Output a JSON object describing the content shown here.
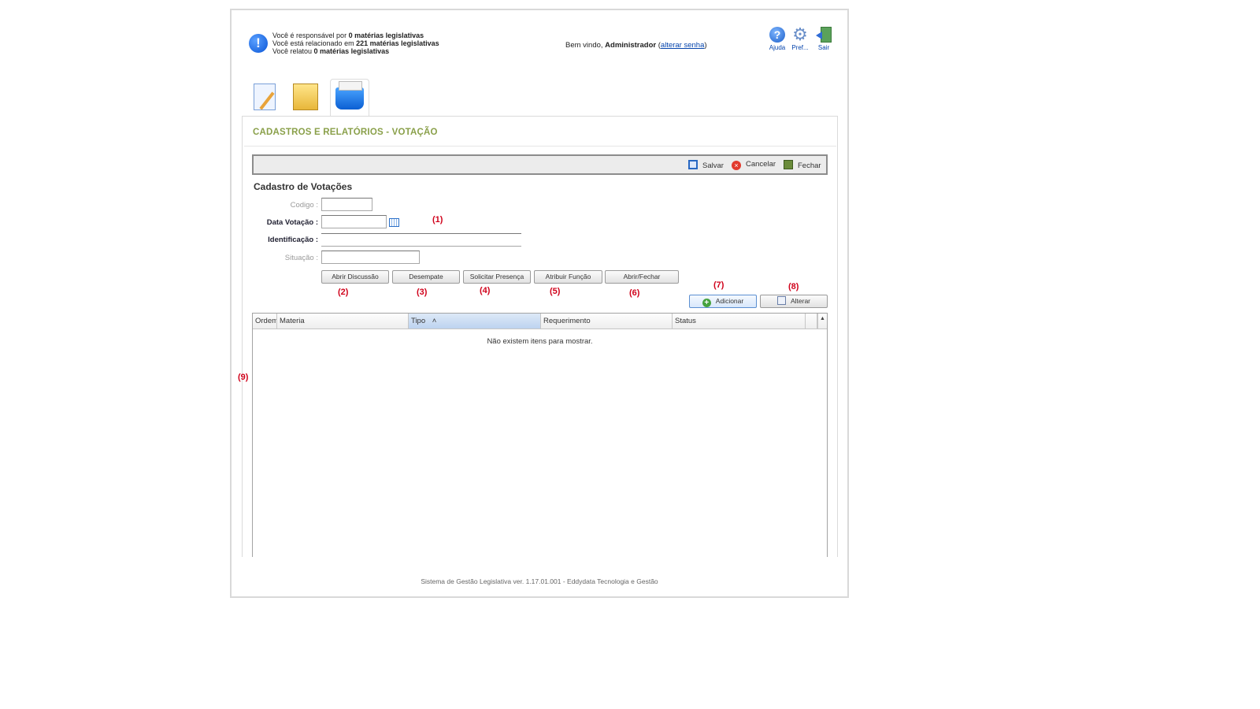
{
  "header": {
    "notices": [
      {
        "prefix": "Você é responsável por ",
        "bold": "0 matérias legislativas"
      },
      {
        "prefix": "Você está relacionado em ",
        "bold": "221 matérias legislativas"
      },
      {
        "prefix": "Você relatou ",
        "bold": "0 matérias legislativas"
      }
    ],
    "welcome_prefix": "Bem vindo, ",
    "user_name": "Administrador",
    "change_password_link": "alterar senha",
    "tools": {
      "help": "Ajuda",
      "prefs": "Pref...",
      "exit": "Sair"
    }
  },
  "panel": {
    "title": "CADASTROS E RELATÓRIOS - VOTAÇÃO",
    "toolbar": {
      "save": "Salvar",
      "cancel": "Cancelar",
      "close": "Fechar"
    },
    "form_title": "Cadastro de Votações",
    "labels": {
      "code": "Codigo :",
      "date": "Data Votação :",
      "identification": "Identificação :",
      "status": "Situação :"
    },
    "values": {
      "code": "",
      "date": "",
      "identification": "",
      "status": ""
    },
    "buttons": {
      "open_discussion": "Abrir Discussão",
      "tiebreak": "Desempate",
      "request_presence": "Solicitar Presença",
      "assign_function": "Atribuir Função",
      "open_close": "Abrir/Fechar",
      "add": "Adicionar",
      "edit": "Alterar"
    }
  },
  "annotations": [
    "(1)",
    "(2)",
    "(3)",
    "(4)",
    "(5)",
    "(6)",
    "(7)",
    "(8)",
    "(9)"
  ],
  "grid": {
    "columns": [
      "Ordem",
      "Materia",
      "Tipo",
      "Requerimento",
      "Status"
    ],
    "sort_indicator": "˄",
    "empty_message": "Não existem itens para mostrar."
  },
  "footer": "Sistema de Gestão Legislativa ver. 1.17.01.001 - Eddydata Tecnologia e Gestão"
}
